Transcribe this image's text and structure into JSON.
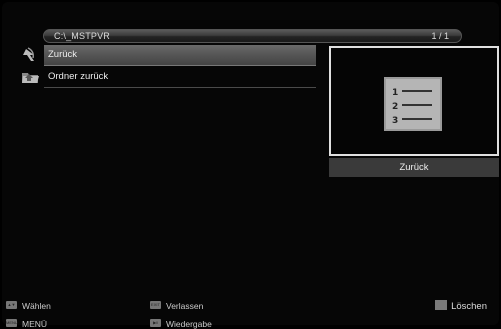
{
  "header": {
    "path": "C:\\_MSTPVR",
    "page_indicator": "1 / 1"
  },
  "file_list": {
    "items": [
      {
        "label": "Zurück",
        "icon": "back-arrow-icon",
        "selected": true
      },
      {
        "label": "Ordner zurück",
        "icon": "folder-up-icon",
        "selected": false
      }
    ]
  },
  "preview": {
    "icon": "list-document-icon",
    "caption": "Zurück"
  },
  "footer": {
    "hints": [
      {
        "key": "ok-updown-key-icon",
        "label": "Wählen"
      },
      {
        "key": "menu-key-icon",
        "label": "MENÜ"
      },
      {
        "key": "exit-key-icon",
        "label": "Verlassen"
      },
      {
        "key": "play-key-icon",
        "label": "Wiedergabe"
      }
    ],
    "delete_label": "Löschen"
  }
}
